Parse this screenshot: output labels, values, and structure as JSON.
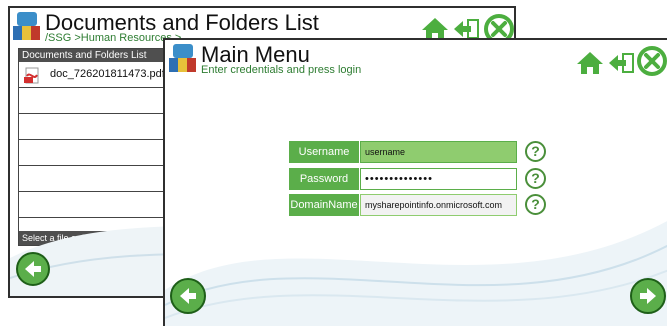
{
  "back_window": {
    "title": "Documents and Folders List",
    "breadcrumb": "/SSG >Human Resources >",
    "list_header": "Documents and Folders List",
    "items": [
      {
        "name": "doc_726201811473.pdf",
        "icon": "pdf-icon"
      },
      {
        "name": ""
      },
      {
        "name": ""
      },
      {
        "name": ""
      },
      {
        "name": ""
      },
      {
        "name": ""
      }
    ],
    "footer": "Select a file or folder from the document"
  },
  "front_window": {
    "title": "Main Menu",
    "subtitle": "Enter credentials and press login",
    "fields": {
      "username": {
        "label": "Username",
        "value": "username"
      },
      "password": {
        "label": "Password",
        "value": "••••••••••••••"
      },
      "domain": {
        "label": "DomainName",
        "value": "mysharepointinfo.onmicrosoft.com"
      }
    },
    "help_glyph": "?"
  },
  "icons": [
    "app-logo-icon",
    "home-icon",
    "exit-icon",
    "close-icon",
    "back-arrow-icon",
    "next-arrow-icon",
    "help-icon",
    "pdf-icon"
  ],
  "colors": {
    "accent_green": "#5bae4a",
    "light_green": "#8fcc6f",
    "dark_green": "#1e5f18",
    "header_gray": "#4f4f4f"
  }
}
